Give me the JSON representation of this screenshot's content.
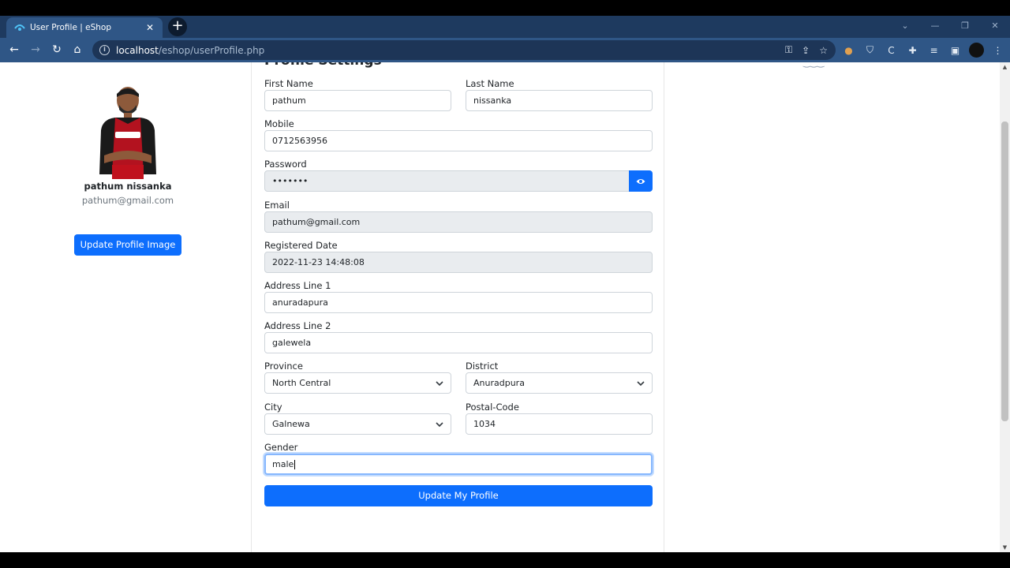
{
  "browser": {
    "tab_title": "User Profile | eShop",
    "url_host": "localhost",
    "url_path": "/eshop/userProfile.php"
  },
  "profile": {
    "name": "pathum nissanka",
    "email": "pathum@gmail.com",
    "update_image_label": "Update Profile Image"
  },
  "form": {
    "title": "Profile Settings",
    "first_name_label": "First Name",
    "first_name_value": "pathum",
    "last_name_label": "Last Name",
    "last_name_value": "nissanka",
    "mobile_label": "Mobile",
    "mobile_value": "0712563956",
    "password_label": "Password",
    "password_value": "•••••••",
    "email_label": "Email",
    "email_value": "pathum@gmail.com",
    "registered_label": "Registered Date",
    "registered_value": "2022-11-23 14:48:08",
    "address1_label": "Address Line 1",
    "address1_value": "anuradapura",
    "address2_label": "Address Line 2",
    "address2_value": "galewela",
    "province_label": "Province",
    "province_value": "North Central",
    "district_label": "District",
    "district_value": "Anuradpura",
    "city_label": "City",
    "city_value": "Galnewa",
    "postal_label": "Postal-Code",
    "postal_value": "1034",
    "gender_label": "Gender",
    "gender_value": "male",
    "submit_label": "Update My Profile"
  },
  "colors": {
    "primary": "#0d6efd",
    "tab_strip": "#1e3a5f",
    "toolbar": "#2f5686"
  }
}
